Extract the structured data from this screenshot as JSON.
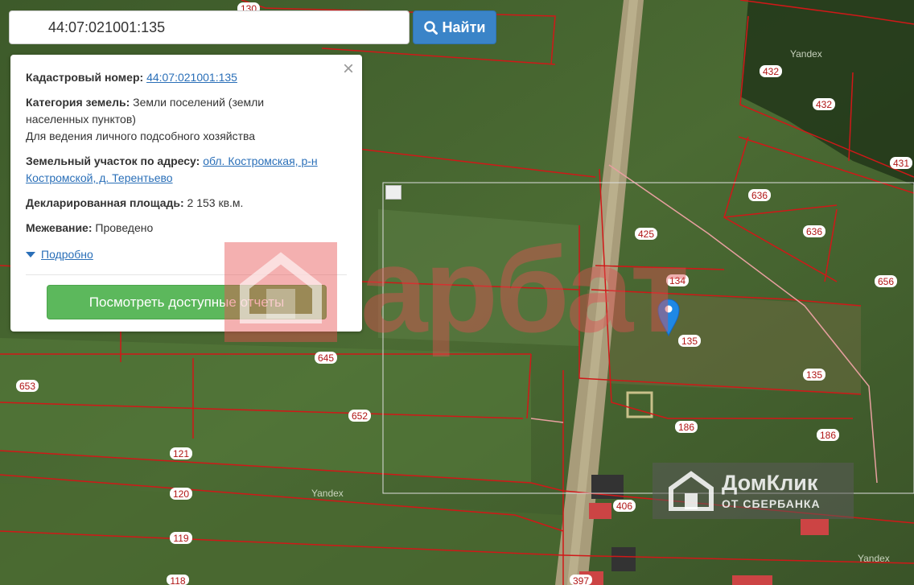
{
  "search": {
    "value": "44:07:021001:135",
    "button_label": "Найти"
  },
  "popup": {
    "close_label": "×",
    "cadastral_label": "Кадастровый номер:",
    "cadastral_value": "44:07:021001:135",
    "category_label": "Категория земель:",
    "category_value_line1": " Земли поселений (земли",
    "category_value_line2": "населенных пунктов)",
    "category_use": "Для ведения личного подсобного хозяйства",
    "address_label": "Земельный участок по адресу:",
    "address_line1": "обл. Костромская, р-н",
    "address_line2": "Костромской, д. Терентьево",
    "area_label": "Декларированная площадь:",
    "area_value": " 2 153 кв.м.",
    "survey_label": "Межевание:",
    "survey_value": " Проведено",
    "more_label": "Подробно",
    "report_button": "Посмотреть доступные отчеты"
  },
  "watermarks": {
    "arbat": "арбат",
    "domclick_title": "ДомКлик",
    "domclick_subtitle": "ОТ СБЕРБАНКА"
  },
  "map_labels": [
    {
      "text": "130"
    },
    {
      "text": "432"
    },
    {
      "text": "432"
    },
    {
      "text": "431"
    },
    {
      "text": "636"
    },
    {
      "text": "636"
    },
    {
      "text": "425"
    },
    {
      "text": "134"
    },
    {
      "text": "656"
    },
    {
      "text": "135"
    },
    {
      "text": "135"
    },
    {
      "text": "645"
    },
    {
      "text": "653"
    },
    {
      "text": "652"
    },
    {
      "text": "186"
    },
    {
      "text": "186"
    },
    {
      "text": "121"
    },
    {
      "text": "120"
    },
    {
      "text": "406"
    },
    {
      "text": "119"
    },
    {
      "text": "118"
    },
    {
      "text": "397"
    }
  ],
  "provider_labels": [
    "Yandex",
    "Yandex",
    "Yandex"
  ],
  "colors": {
    "boundary": "#d01818",
    "accent": "#3a84c8",
    "button_green": "#5cb85c"
  }
}
